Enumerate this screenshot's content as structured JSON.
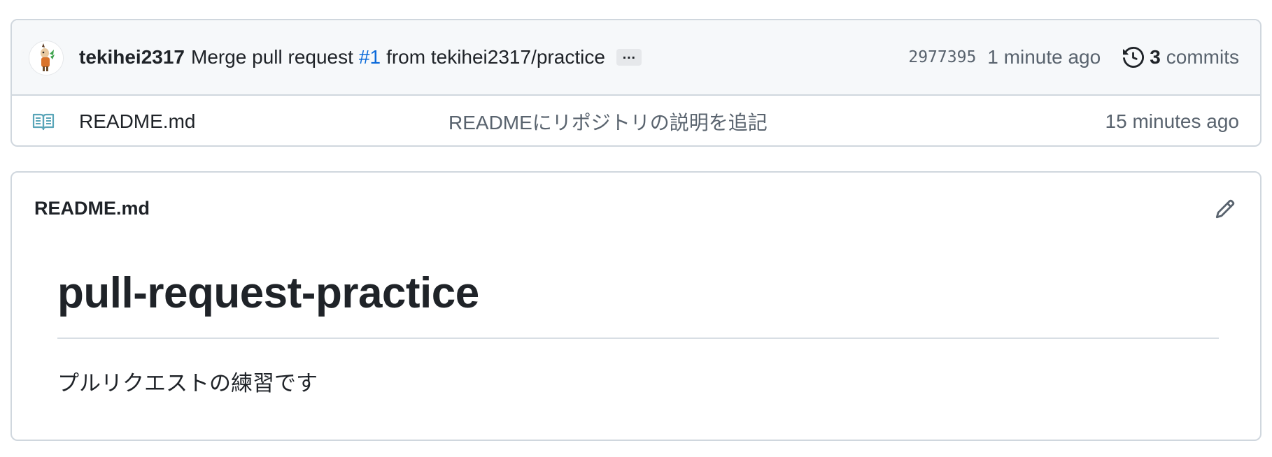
{
  "latest_commit": {
    "author": "tekihei2317",
    "message_prefix": "Merge pull request",
    "pr_link": "#1",
    "message_suffix": "from tekihei2317/practice",
    "ellipsis": "…",
    "sha": "2977395",
    "age": "1 minute ago",
    "commit_count": "3",
    "commits_label": "commits"
  },
  "files": [
    {
      "name": "README.md",
      "icon": "book-icon",
      "commit_message": "READMEにリポジトリの説明を追記",
      "age": "15 minutes ago"
    }
  ],
  "readme": {
    "header": "README.md",
    "edit_icon": "pencil-icon",
    "heading": "pull-request-practice",
    "paragraph": "プルリクエストの練習です"
  },
  "colors": {
    "link": "#0969da",
    "border": "#d0d7de",
    "header_bg": "#f6f8fa",
    "muted_text": "#59636e",
    "text": "#1f2328"
  }
}
